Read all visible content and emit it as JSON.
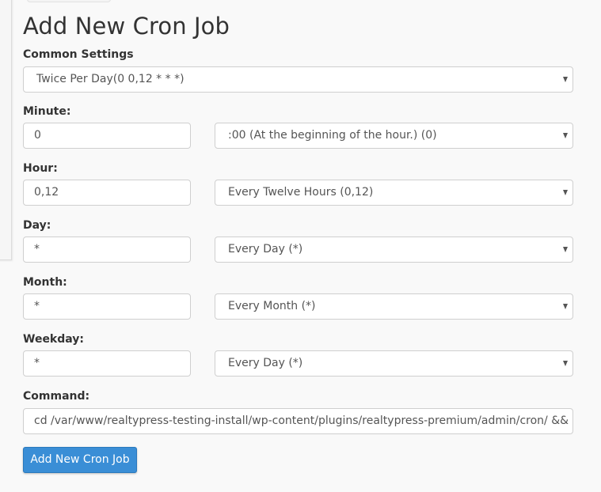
{
  "page": {
    "title": "Add New Cron Job"
  },
  "common_settings": {
    "label": "Common Settings",
    "selected": "Twice Per Day(0 0,12 * * *)"
  },
  "fields": [
    {
      "key": "minute",
      "label": "Minute:",
      "value": "0",
      "select": ":00 (At the beginning of the hour.) (0)"
    },
    {
      "key": "hour",
      "label": "Hour:",
      "value": "0,12",
      "select": "Every Twelve Hours (0,12)"
    },
    {
      "key": "day",
      "label": "Day:",
      "value": "*",
      "select": "Every Day (*)"
    },
    {
      "key": "month",
      "label": "Month:",
      "value": "*",
      "select": "Every Month (*)"
    },
    {
      "key": "weekday",
      "label": "Weekday:",
      "value": "*",
      "select": "Every Day (*)"
    }
  ],
  "command": {
    "label": "Command:",
    "value": "cd /var/www/realtypress-testing-install/wp-content/plugins/realtypress-premium/admin/cron/ && php ·"
  },
  "submit": {
    "label": "Add New Cron Job"
  },
  "icons": {
    "dropdown": "caret-down-icon"
  },
  "colors": {
    "primary_button": "#3a8ed6",
    "background": "#f9f9f9",
    "text": "#333333"
  }
}
